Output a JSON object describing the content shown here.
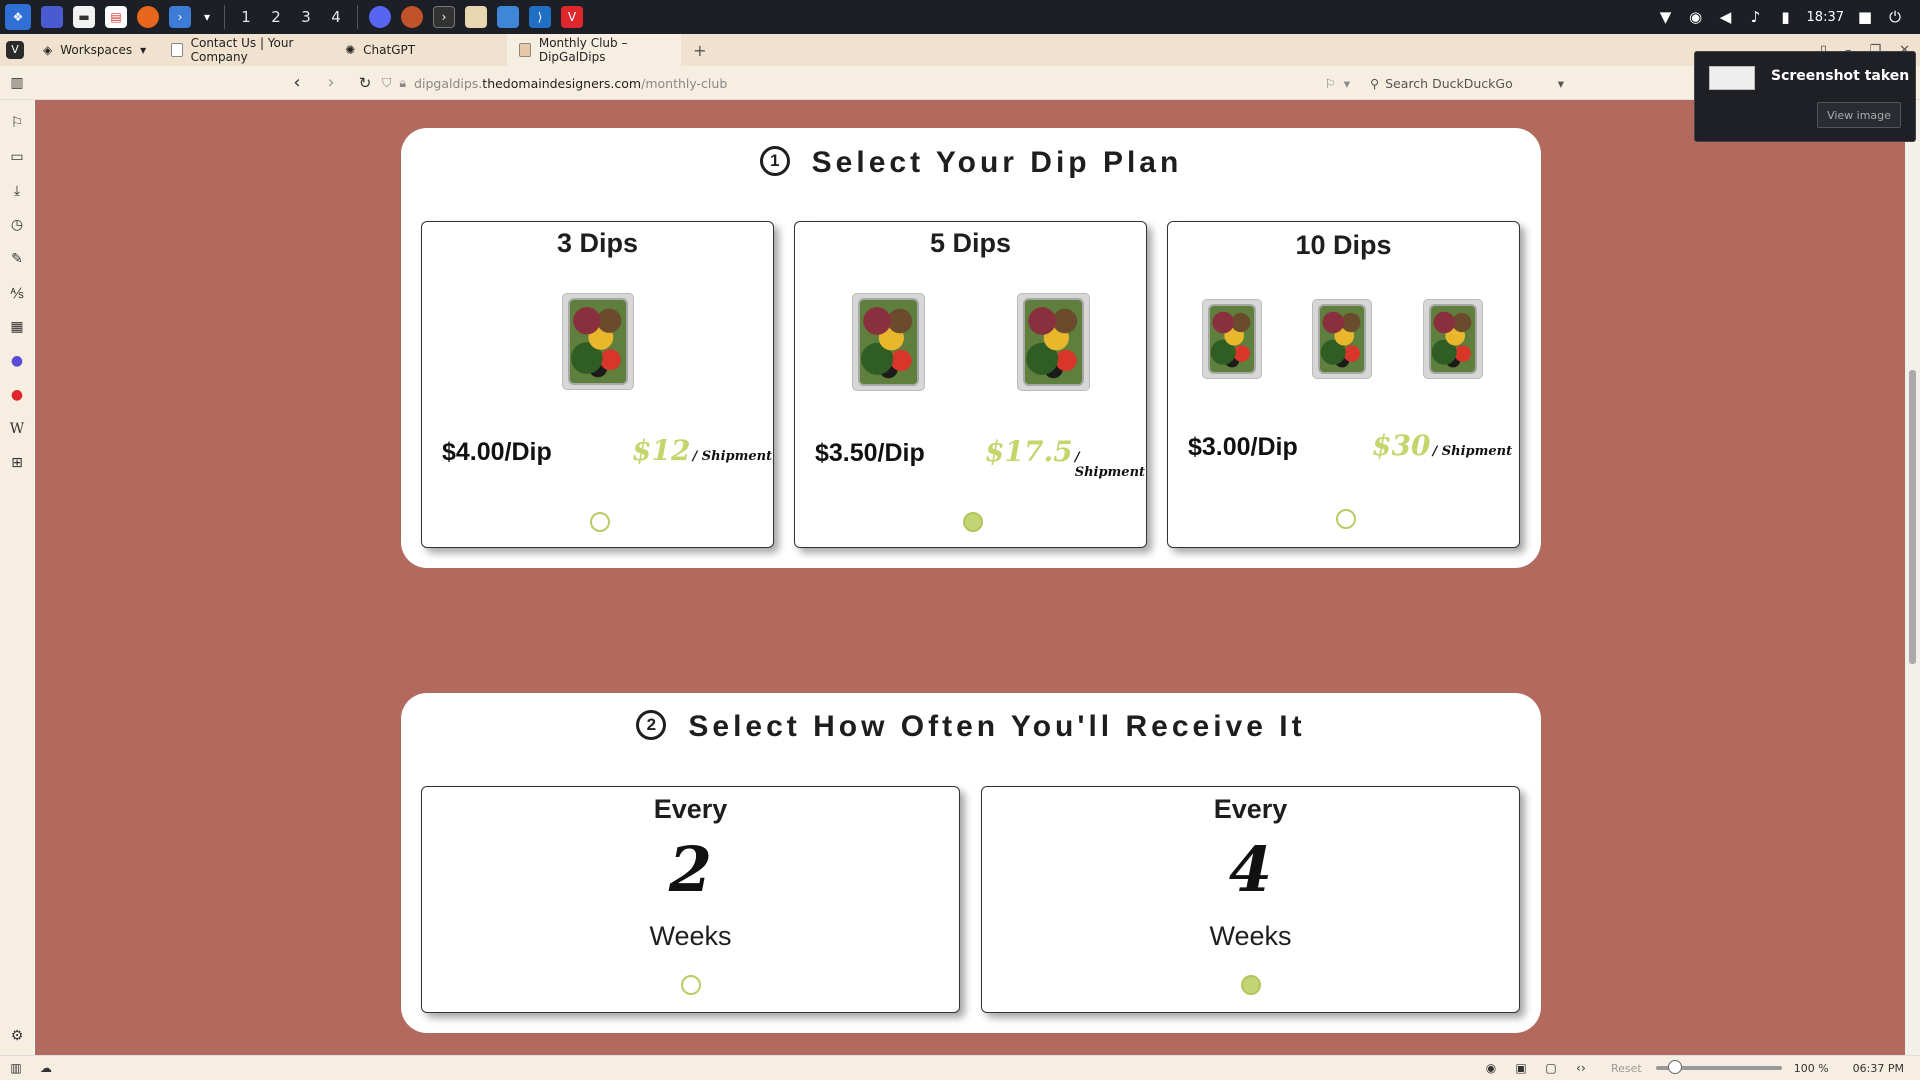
{
  "taskbar": {
    "workspaces": [
      "1",
      "2",
      "3",
      "4"
    ],
    "clock": "18:37"
  },
  "browser": {
    "workspaces_label": "Workspaces",
    "tabs": [
      {
        "label": "Contact Us | Your Company"
      },
      {
        "label": "ChatGPT"
      },
      {
        "label": "Monthly Club – DipGalDips"
      }
    ],
    "url_subdomain": "dipgaldips.",
    "url_host": "thedomaindesigners.com",
    "url_path": "/monthly-club",
    "search_placeholder": "Search DuckDuckGo"
  },
  "toast": {
    "title": "Screenshot taken",
    "button": "View image"
  },
  "plan_section": {
    "step": "1",
    "title": "Select Your Dip Plan",
    "plans": [
      {
        "title": "3 Dips",
        "price": "$4.00/Dip",
        "shipment_amount": "$12",
        "shipment_label": "/ Shipment",
        "selected": false
      },
      {
        "title": "5 Dips",
        "price": "$3.50/Dip",
        "shipment_amount": "$17.5",
        "shipment_label": "/ Shipment",
        "selected": true
      },
      {
        "title": "10 Dips",
        "price": "$3.00/Dip",
        "shipment_amount": "$30",
        "shipment_label": "/ Shipment",
        "selected": false
      }
    ]
  },
  "frequency_section": {
    "step": "2",
    "title": "Select How Often You'll Receive It",
    "options": [
      {
        "every": "Every",
        "number": "2",
        "unit": "Weeks",
        "selected": false
      },
      {
        "every": "Every",
        "number": "4",
        "unit": "Weeks",
        "selected": true
      }
    ]
  },
  "statusbar": {
    "reset": "Reset",
    "zoom": "100 %",
    "time": "06:37 PM"
  },
  "colors": {
    "page_background": "#b36a5e",
    "accent_green": "#c3d66b"
  }
}
